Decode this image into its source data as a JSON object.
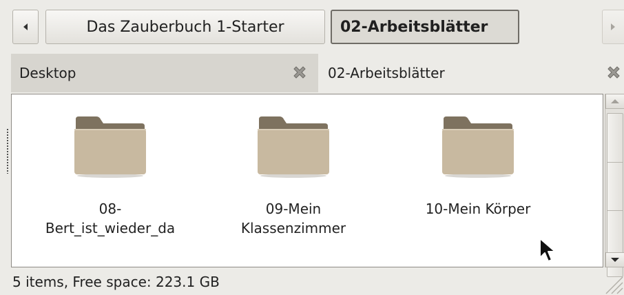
{
  "pathbar": {
    "crumbs": [
      "Das Zauberbuch 1-Starter",
      "02-Arbeitsblätter"
    ],
    "active_index": 1
  },
  "pane_tabs": [
    {
      "label": "Desktop",
      "active": false
    },
    {
      "label": "02-Arbeitsblätter",
      "active": true
    }
  ],
  "files": [
    {
      "label": "08-\nBert_ist_wieder_da",
      "icon": "folder-icon"
    },
    {
      "label": "09-Mein\nKlassenzimmer",
      "icon": "folder-icon"
    },
    {
      "label": "10-Mein Körper",
      "icon": "folder-icon"
    }
  ],
  "statusbar": {
    "text": "5 items, Free space: 223.1 GB"
  },
  "colors": {
    "background": "#ecebe7",
    "folder": "#c8b9a0",
    "folder_tab": "#7e725f"
  }
}
